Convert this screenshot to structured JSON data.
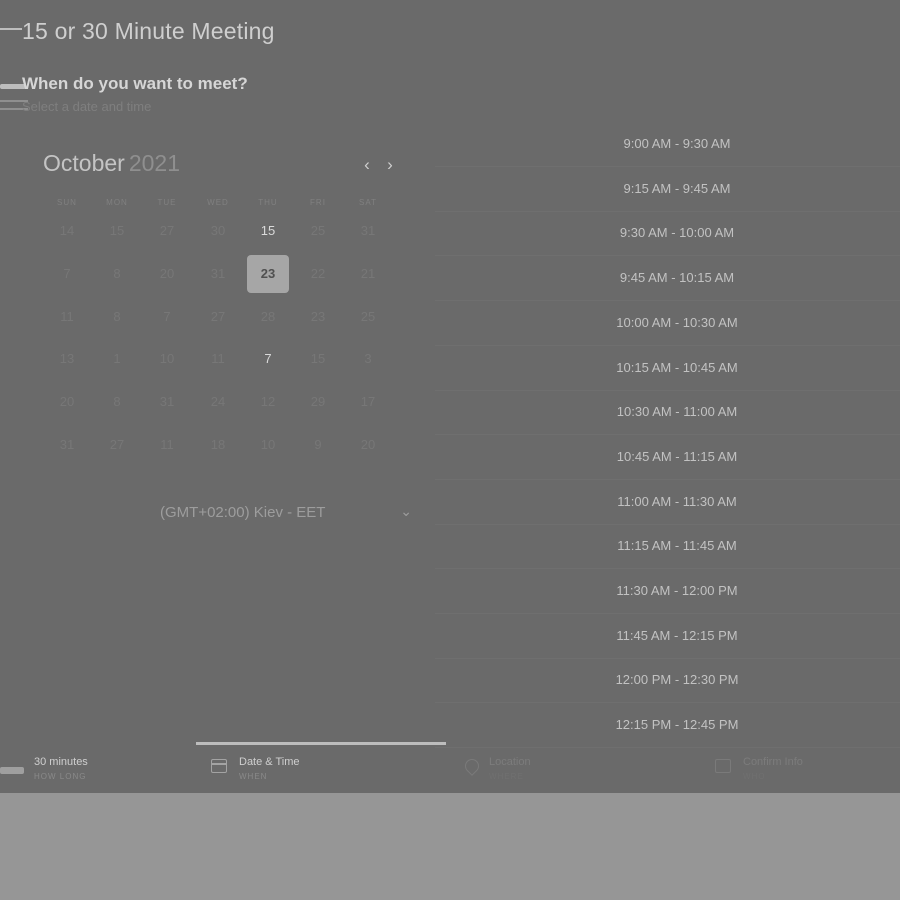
{
  "header": {
    "title": "15 or 30 Minute Meeting",
    "question": "When do you want to meet?",
    "subtitle": "Select a date and time"
  },
  "calendar": {
    "month": "October",
    "year": "2021",
    "prev_icon": "chevron-left-icon",
    "next_icon": "chevron-right-icon",
    "weekdays": [
      "SUN",
      "MON",
      "TUE",
      "WED",
      "THU",
      "FRI",
      "SAT"
    ],
    "weeks": [
      [
        {
          "d": "14"
        },
        {
          "d": "15"
        },
        {
          "d": "27"
        },
        {
          "d": "30"
        },
        {
          "d": "15",
          "available": true
        },
        {
          "d": "25"
        },
        {
          "d": "31"
        }
      ],
      [
        {
          "d": "7"
        },
        {
          "d": "8"
        },
        {
          "d": "20"
        },
        {
          "d": "31"
        },
        {
          "d": "23",
          "selected": true
        },
        {
          "d": "22"
        },
        {
          "d": "21"
        }
      ],
      [
        {
          "d": "11"
        },
        {
          "d": "8"
        },
        {
          "d": "7"
        },
        {
          "d": "27"
        },
        {
          "d": "28"
        },
        {
          "d": "23"
        },
        {
          "d": "25"
        }
      ],
      [
        {
          "d": "13"
        },
        {
          "d": "1"
        },
        {
          "d": "10"
        },
        {
          "d": "11"
        },
        {
          "d": "7",
          "available": true
        },
        {
          "d": "15"
        },
        {
          "d": "3"
        }
      ],
      [
        {
          "d": "20"
        },
        {
          "d": "8"
        },
        {
          "d": "31"
        },
        {
          "d": "24"
        },
        {
          "d": "12"
        },
        {
          "d": "29"
        },
        {
          "d": "17"
        }
      ],
      [
        {
          "d": "31"
        },
        {
          "d": "27"
        },
        {
          "d": "11"
        },
        {
          "d": "18"
        },
        {
          "d": "10"
        },
        {
          "d": "9"
        },
        {
          "d": "20"
        }
      ]
    ],
    "timezone": "(GMT+02:00) Kiev - EET",
    "timezone_icon": "chevron-down-icon"
  },
  "time_slots": [
    "9:00 AM - 9:30 AM",
    "9:15 AM - 9:45 AM",
    "9:30 AM - 10:00 AM",
    "9:45 AM - 10:15 AM",
    "10:00 AM - 10:30 AM",
    "10:15 AM - 10:45 AM",
    "10:30 AM - 11:00 AM",
    "10:45 AM - 11:15 AM",
    "11:00 AM - 11:30 AM",
    "11:15 AM - 11:45 AM",
    "11:30 AM - 12:00 PM",
    "11:45 AM - 12:15 PM",
    "12:00 PM - 12:30 PM",
    "12:15 PM - 12:45 PM"
  ],
  "footer": {
    "steps": [
      {
        "title": "30 minutes",
        "sub": "HOW LONG",
        "icon": "duration-icon"
      },
      {
        "title": "Date & Time",
        "sub": "WHEN",
        "icon": "calendar-icon",
        "active": true
      },
      {
        "title": "Location",
        "sub": "WHERE",
        "icon": "location-pin-icon"
      },
      {
        "title": "Confirm Info",
        "sub": "WHO",
        "icon": "confirm-icon"
      }
    ]
  }
}
